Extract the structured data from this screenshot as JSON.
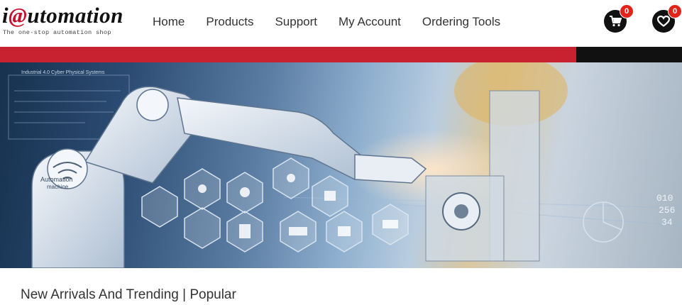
{
  "brand": {
    "logo_prefix": "i",
    "logo_at": "@",
    "logo_suffix": "utomation",
    "tagline": "The one-stop automation shop"
  },
  "nav": {
    "items": [
      {
        "label": "Home"
      },
      {
        "label": "Products"
      },
      {
        "label": "Support"
      },
      {
        "label": "My Account"
      },
      {
        "label": "Ordering Tools"
      }
    ]
  },
  "header_icons": {
    "cart": {
      "icon": "cart-icon",
      "count": "0"
    },
    "wishlist": {
      "icon": "heart-icon",
      "count": "0"
    }
  },
  "banner": {
    "robot_label": "Automation",
    "robot_label2": "machine",
    "panel_heading": "Industrial 4.0 Cyber Physical Systems",
    "digits": [
      "010",
      "256",
      "34"
    ]
  },
  "colors": {
    "brand_red": "#c8212f",
    "badge_red": "#e2231a",
    "dark": "#111111"
  },
  "section": {
    "title": "New Arrivals And Trending | Popular"
  }
}
